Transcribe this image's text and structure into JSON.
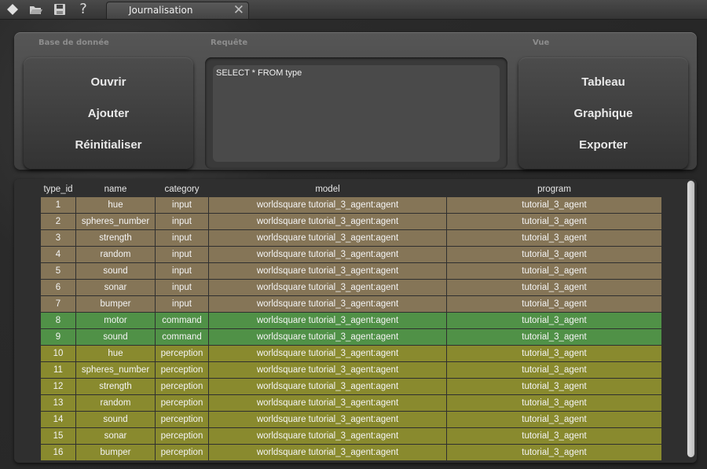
{
  "toolbar": {
    "icons": [
      "diamond-icon",
      "open-folder-icon",
      "save-icon",
      "help-icon"
    ],
    "help_glyph": "?"
  },
  "tab": {
    "label": "Journalisation",
    "close_glyph": "✕"
  },
  "database_group": {
    "title": "Base de donnée",
    "buttons": [
      "Ouvrir",
      "Ajouter",
      "Réinitialiser"
    ]
  },
  "query_group": {
    "title": "Requête",
    "query": "SELECT * FROM type"
  },
  "view_group": {
    "title": "Vue",
    "buttons": [
      "Tableau",
      "Graphique",
      "Exporter"
    ]
  },
  "table": {
    "columns": [
      "type_id",
      "name",
      "category",
      "model",
      "program"
    ],
    "rows": [
      [
        "1",
        "hue",
        "input",
        "worldsquare tutorial_3_agent:agent",
        "tutorial_3_agent"
      ],
      [
        "2",
        "spheres_number",
        "input",
        "worldsquare tutorial_3_agent:agent",
        "tutorial_3_agent"
      ],
      [
        "3",
        "strength",
        "input",
        "worldsquare tutorial_3_agent:agent",
        "tutorial_3_agent"
      ],
      [
        "4",
        "random",
        "input",
        "worldsquare tutorial_3_agent:agent",
        "tutorial_3_agent"
      ],
      [
        "5",
        "sound",
        "input",
        "worldsquare tutorial_3_agent:agent",
        "tutorial_3_agent"
      ],
      [
        "6",
        "sonar",
        "input",
        "worldsquare tutorial_3_agent:agent",
        "tutorial_3_agent"
      ],
      [
        "7",
        "bumper",
        "input",
        "worldsquare tutorial_3_agent:agent",
        "tutorial_3_agent"
      ],
      [
        "8",
        "motor",
        "command",
        "worldsquare tutorial_3_agent:agent",
        "tutorial_3_agent"
      ],
      [
        "9",
        "sound",
        "command",
        "worldsquare tutorial_3_agent:agent",
        "tutorial_3_agent"
      ],
      [
        "10",
        "hue",
        "perception",
        "worldsquare tutorial_3_agent:agent",
        "tutorial_3_agent"
      ],
      [
        "11",
        "spheres_number",
        "perception",
        "worldsquare tutorial_3_agent:agent",
        "tutorial_3_agent"
      ],
      [
        "12",
        "strength",
        "perception",
        "worldsquare tutorial_3_agent:agent",
        "tutorial_3_agent"
      ],
      [
        "13",
        "random",
        "perception",
        "worldsquare tutorial_3_agent:agent",
        "tutorial_3_agent"
      ],
      [
        "14",
        "sound",
        "perception",
        "worldsquare tutorial_3_agent:agent",
        "tutorial_3_agent"
      ],
      [
        "15",
        "sonar",
        "perception",
        "worldsquare tutorial_3_agent:agent",
        "tutorial_3_agent"
      ],
      [
        "16",
        "bumper",
        "perception",
        "worldsquare tutorial_3_agent:agent",
        "tutorial_3_agent"
      ]
    ]
  },
  "colors": {
    "input": "#857557",
    "command": "#509147",
    "perception": "#898a2e"
  }
}
